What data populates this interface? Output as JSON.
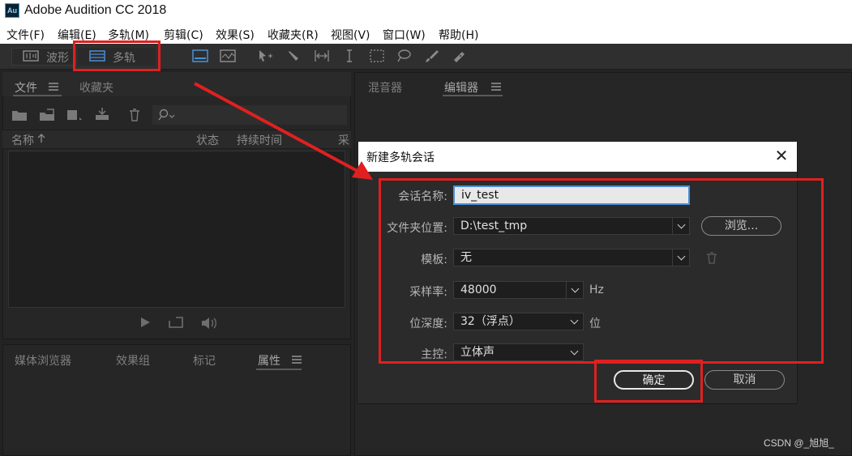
{
  "app": {
    "title": "Adobe Audition CC 2018",
    "logo_text": "Au"
  },
  "menu": [
    "文件(F)",
    "编辑(E)",
    "多轨(M)",
    "剪辑(C)",
    "效果(S)",
    "收藏夹(R)",
    "视图(V)",
    "窗口(W)",
    "帮助(H)"
  ],
  "toolbar": {
    "waveform_label": "波形",
    "multitrack_label": "多轨"
  },
  "files_panel": {
    "tabs": [
      "文件",
      "收藏夹"
    ],
    "columns": {
      "name": "名称",
      "status": "状态",
      "duration": "持续时间",
      "extra": "采"
    }
  },
  "bottom_panel": {
    "tabs": [
      "媒体浏览器",
      "效果组",
      "标记",
      "属性"
    ]
  },
  "right_panel": {
    "tabs": [
      "混音器",
      "编辑器"
    ]
  },
  "dialog": {
    "title": "新建多轨会话",
    "close_glyph": "✕",
    "session_name": {
      "label": "会话名称:",
      "value": "iv_test"
    },
    "folder": {
      "label": "文件夹位置:",
      "value": "D:\\test_tmp",
      "browse": "浏览..."
    },
    "template": {
      "label": "模板:",
      "value": "无"
    },
    "sample_rate": {
      "label": "采样率:",
      "value": "48000",
      "unit": "Hz"
    },
    "bit_depth": {
      "label": "位深度:",
      "value": "32（浮点）",
      "unit": "位"
    },
    "master": {
      "label": "主控:",
      "value": "立体声"
    },
    "ok": "确定",
    "cancel": "取消"
  },
  "watermark": "CSDN @_旭旭_",
  "colors": {
    "annotation_red": "#e02020",
    "title_bar": "#ffffff",
    "panel_bg": "#262626"
  }
}
